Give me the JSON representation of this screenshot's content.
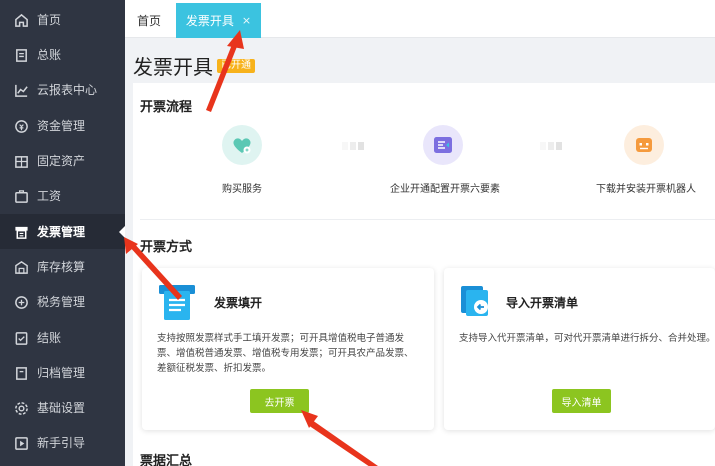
{
  "sidebar": {
    "items": [
      {
        "label": "首页",
        "icon": "home-icon"
      },
      {
        "label": "总账",
        "icon": "ledger-icon"
      },
      {
        "label": "云报表中心",
        "icon": "chart-icon"
      },
      {
        "label": "资金管理",
        "icon": "money-icon"
      },
      {
        "label": "固定资产",
        "icon": "asset-icon"
      },
      {
        "label": "工资",
        "icon": "salary-icon"
      },
      {
        "label": "发票管理",
        "icon": "invoice-icon"
      },
      {
        "label": "库存核算",
        "icon": "warehouse-icon"
      },
      {
        "label": "税务管理",
        "icon": "tax-icon"
      },
      {
        "label": "结账",
        "icon": "checkout-icon"
      },
      {
        "label": "归档管理",
        "icon": "archive-icon"
      },
      {
        "label": "基础设置",
        "icon": "gear-icon"
      },
      {
        "label": "新手引导",
        "icon": "play-icon"
      }
    ],
    "active": "发票管理"
  },
  "tabs": {
    "home": "首页",
    "active": "发票开具",
    "close": "×"
  },
  "page": {
    "title": "发票开具",
    "badge": "已开通"
  },
  "flow": {
    "title": "开票流程",
    "steps": [
      {
        "label": "购买服务",
        "icon": "heart-icon",
        "color": "#5bc8b4"
      },
      {
        "label": "企业开通配置开票六要素",
        "icon": "config-icon",
        "color": "#7c6fe0"
      },
      {
        "label": "下载并安装开票机器人",
        "icon": "robot-icon",
        "color": "#f59a3d"
      }
    ]
  },
  "methods": {
    "title": "开票方式",
    "cards": [
      {
        "title": "发票填开",
        "desc_lines": [
          "支持按照发票样式手工填开发票；可开具增值税电子普通发",
          "票、增值税普通发票、增值税专用发票；可开具农产品发票、",
          "差额征税发票、折扣发票。"
        ],
        "button": "去开票",
        "icon": "invoice-form-icon"
      },
      {
        "title": "导入开票清单",
        "desc_lines": [
          "支持导入代开票清单，可对代开票清单进行拆分、合并处理。"
        ],
        "button": "导入清单",
        "icon": "import-icon"
      }
    ]
  },
  "summary": {
    "title": "票据汇总"
  },
  "colors": {
    "sidebar": "#2f3542",
    "accent": "#3bc3e0",
    "button": "#8cc520",
    "annotation": "#e8341c"
  }
}
